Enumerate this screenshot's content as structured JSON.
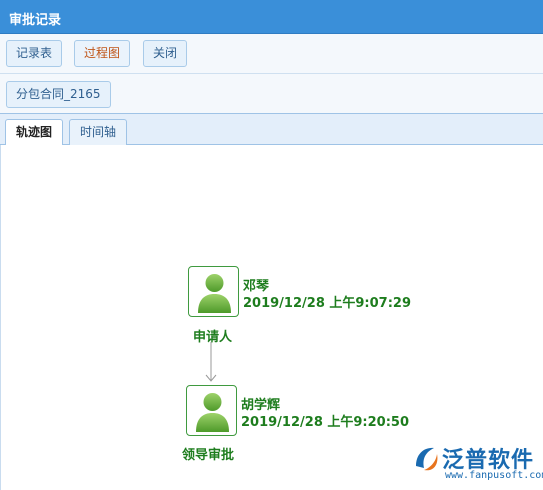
{
  "window": {
    "title": "审批记录"
  },
  "toolbar": {
    "records_label": "记录表",
    "process_label": "过程图",
    "close_label": "关闭"
  },
  "document": {
    "name": "分包合同_2165"
  },
  "tabs": [
    {
      "label": "轨迹图",
      "selected": true
    },
    {
      "label": "时间轴",
      "selected": false
    }
  ],
  "flow": {
    "nodes": [
      {
        "name": "邓琴",
        "time": "2019/12/28 上午9:07:29",
        "role": "申请人"
      },
      {
        "name": "胡学辉",
        "time": "2019/12/28 上午9:20:50",
        "role": "领导审批"
      }
    ]
  },
  "watermark": {
    "brand": "泛普软件",
    "url": "www.fanpusoft.com",
    "icon": "fanpu-logo-icon"
  },
  "colors": {
    "title_bar": "#3a8fd9",
    "node_border": "#3f9a3f",
    "node_text": "#1e7d1e",
    "brand": "#1a6ab0"
  }
}
